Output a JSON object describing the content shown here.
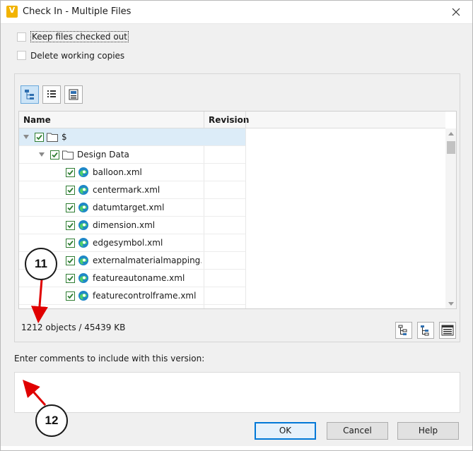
{
  "window": {
    "title": "Check In - Multiple Files",
    "app_icon_letter": "V",
    "close_icon": "close-icon"
  },
  "options": {
    "keep_checked_out_label": "Keep files checked out",
    "keep_checked_out": false,
    "delete_working_label": "Delete working copies",
    "delete_working": false
  },
  "toolbar": {
    "icons": [
      "tree-view-icon",
      "list-view-icon",
      "details-view-icon"
    ],
    "active": "tree-view-icon"
  },
  "grid": {
    "columns": {
      "name": "Name",
      "revision": "Revision"
    },
    "rows": [
      {
        "label": "$",
        "type": "folder",
        "checked": true,
        "expanded": true,
        "selected": true
      },
      {
        "label": "Design Data",
        "type": "folder",
        "checked": true,
        "expanded": true
      },
      {
        "label": "balloon.xml",
        "type": "file",
        "checked": true
      },
      {
        "label": "centermark.xml",
        "type": "file",
        "checked": true
      },
      {
        "label": "datumtarget.xml",
        "type": "file",
        "checked": true
      },
      {
        "label": "dimension.xml",
        "type": "file",
        "checked": true
      },
      {
        "label": "edgesymbol.xml",
        "type": "file",
        "checked": true
      },
      {
        "label": "externalmaterialmapping.x...",
        "type": "file",
        "checked": true
      },
      {
        "label": "featureautoname.xml",
        "type": "file",
        "checked": true
      },
      {
        "label": "featurecontrolframe.xml",
        "type": "file",
        "checked": true
      }
    ]
  },
  "status": {
    "summary": "1212 objects / 45439 KB"
  },
  "status_buttons": [
    "expand-all-icon",
    "collapse-all-icon",
    "settings-list-icon"
  ],
  "comments": {
    "label": "Enter comments to include with this version:",
    "value": ""
  },
  "buttons": {
    "ok": "OK",
    "cancel": "Cancel",
    "help": "Help"
  },
  "callouts": [
    {
      "number": "11"
    },
    {
      "number": "12"
    }
  ],
  "colors": {
    "accent": "#0078d7",
    "callout_arrow": "#e00000",
    "check_green": "#2e7d32",
    "app_icon": "#f2b300"
  }
}
